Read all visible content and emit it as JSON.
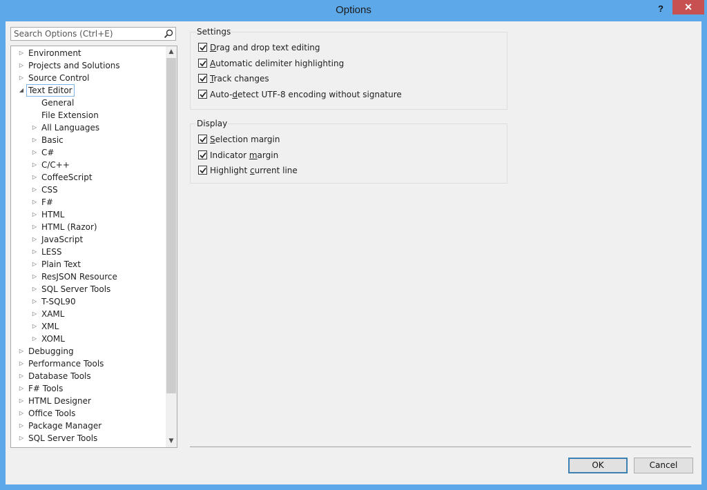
{
  "window": {
    "title": "Options"
  },
  "titlebar": {
    "help": "?",
    "close": "✕"
  },
  "search": {
    "placeholder": "Search Options (Ctrl+E)"
  },
  "tree": [
    {
      "label": "Environment",
      "level": 0,
      "expander": "collapsed"
    },
    {
      "label": "Projects and Solutions",
      "level": 0,
      "expander": "collapsed"
    },
    {
      "label": "Source Control",
      "level": 0,
      "expander": "collapsed"
    },
    {
      "label": "Text Editor",
      "level": 0,
      "expander": "expanded",
      "selected": true
    },
    {
      "label": "General",
      "level": 1,
      "expander": "none"
    },
    {
      "label": "File Extension",
      "level": 1,
      "expander": "none"
    },
    {
      "label": "All Languages",
      "level": 1,
      "expander": "collapsed"
    },
    {
      "label": "Basic",
      "level": 1,
      "expander": "collapsed"
    },
    {
      "label": "C#",
      "level": 1,
      "expander": "collapsed"
    },
    {
      "label": "C/C++",
      "level": 1,
      "expander": "collapsed"
    },
    {
      "label": "CoffeeScript",
      "level": 1,
      "expander": "collapsed"
    },
    {
      "label": "CSS",
      "level": 1,
      "expander": "collapsed"
    },
    {
      "label": "F#",
      "level": 1,
      "expander": "collapsed"
    },
    {
      "label": "HTML",
      "level": 1,
      "expander": "collapsed"
    },
    {
      "label": "HTML (Razor)",
      "level": 1,
      "expander": "collapsed"
    },
    {
      "label": "JavaScript",
      "level": 1,
      "expander": "collapsed"
    },
    {
      "label": "LESS",
      "level": 1,
      "expander": "collapsed"
    },
    {
      "label": "Plain Text",
      "level": 1,
      "expander": "collapsed"
    },
    {
      "label": "ResJSON Resource",
      "level": 1,
      "expander": "collapsed"
    },
    {
      "label": "SQL Server Tools",
      "level": 1,
      "expander": "collapsed"
    },
    {
      "label": "T-SQL90",
      "level": 1,
      "expander": "collapsed"
    },
    {
      "label": "XAML",
      "level": 1,
      "expander": "collapsed"
    },
    {
      "label": "XML",
      "level": 1,
      "expander": "collapsed"
    },
    {
      "label": "XOML",
      "level": 1,
      "expander": "collapsed"
    },
    {
      "label": "Debugging",
      "level": 0,
      "expander": "collapsed"
    },
    {
      "label": "Performance Tools",
      "level": 0,
      "expander": "collapsed"
    },
    {
      "label": "Database Tools",
      "level": 0,
      "expander": "collapsed"
    },
    {
      "label": "F# Tools",
      "level": 0,
      "expander": "collapsed"
    },
    {
      "label": "HTML Designer",
      "level": 0,
      "expander": "collapsed"
    },
    {
      "label": "Office Tools",
      "level": 0,
      "expander": "collapsed"
    },
    {
      "label": "Package Manager",
      "level": 0,
      "expander": "collapsed"
    },
    {
      "label": "SQL Server Tools",
      "level": 0,
      "expander": "collapsed"
    }
  ],
  "settings": {
    "title": "Settings",
    "items": [
      {
        "label": "Drag and drop text editing",
        "mnemonic": "D",
        "checked": true
      },
      {
        "label": "Automatic delimiter highlighting",
        "mnemonic": "A",
        "checked": true
      },
      {
        "label": "Track changes",
        "mnemonic": "T",
        "checked": true
      },
      {
        "label": "Auto-detect UTF-8 encoding without signature",
        "mnemonic": "d",
        "checked": true
      }
    ]
  },
  "display": {
    "title": "Display",
    "items": [
      {
        "label": "Selection margin",
        "mnemonic": "S",
        "checked": true
      },
      {
        "label": "Indicator margin",
        "mnemonic": "m",
        "checked": true
      },
      {
        "label": "Highlight current line",
        "mnemonic": "c",
        "checked": true
      }
    ]
  },
  "buttons": {
    "ok": "OK",
    "cancel": "Cancel"
  },
  "colors": {
    "titlebar": "#5da8e8",
    "close": "#c75050",
    "client": "#f0f0f0",
    "selection_border": "#7eb4ea"
  }
}
